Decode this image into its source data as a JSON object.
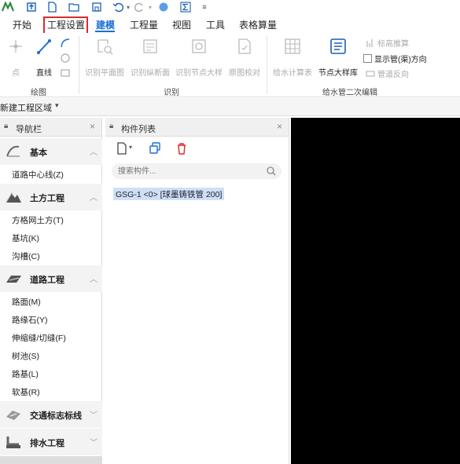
{
  "menu": {
    "tabs": [
      "开始",
      "工程设置",
      "建模",
      "工程量",
      "视图",
      "工具",
      "表格算量"
    ],
    "active_index": 2,
    "highlighted_index": 1
  },
  "ribbon": {
    "draw_group": {
      "label": "绘图",
      "point": "点",
      "line": "直线"
    },
    "identify_group": {
      "label": "识别",
      "items": [
        "识别平面图",
        "识别纵断面",
        "识别节点大样",
        "原图校对"
      ]
    },
    "secondary_group": {
      "label": "给水管二次编辑",
      "water_calc": "给水计算表",
      "node_library": "节点大样库",
      "elevation_push": "标高推算",
      "show_direction": "显示管(渠)方向",
      "pipe_reverse": "管道反向"
    }
  },
  "region": {
    "label": "新建工程区域"
  },
  "nav": {
    "title": "导航栏",
    "categories": [
      {
        "label": "基本",
        "items": [
          "道路中心线(Z)"
        ]
      },
      {
        "label": "土方工程",
        "items": [
          "方格网土方(T)",
          "基坑(K)",
          "沟槽(C)"
        ]
      },
      {
        "label": "道路工程",
        "items": [
          "路面(M)",
          "路缘石(Y)",
          "伸缩缝/切缝(F)",
          "树池(S)",
          "路基(L)",
          "软基(R)"
        ]
      },
      {
        "label": "交通标志标线",
        "items": []
      },
      {
        "label": "排水工程",
        "items": []
      }
    ]
  },
  "components": {
    "title": "构件列表",
    "search_placeholder": "搜索构件...",
    "items": [
      "GSG-1 <0> [球墨铸铁管 200]"
    ]
  },
  "colors": {
    "accent": "#1a6fd6",
    "highlight_box": "#e0282d",
    "selection": "#cfe0f4",
    "canvas": "#000000"
  }
}
